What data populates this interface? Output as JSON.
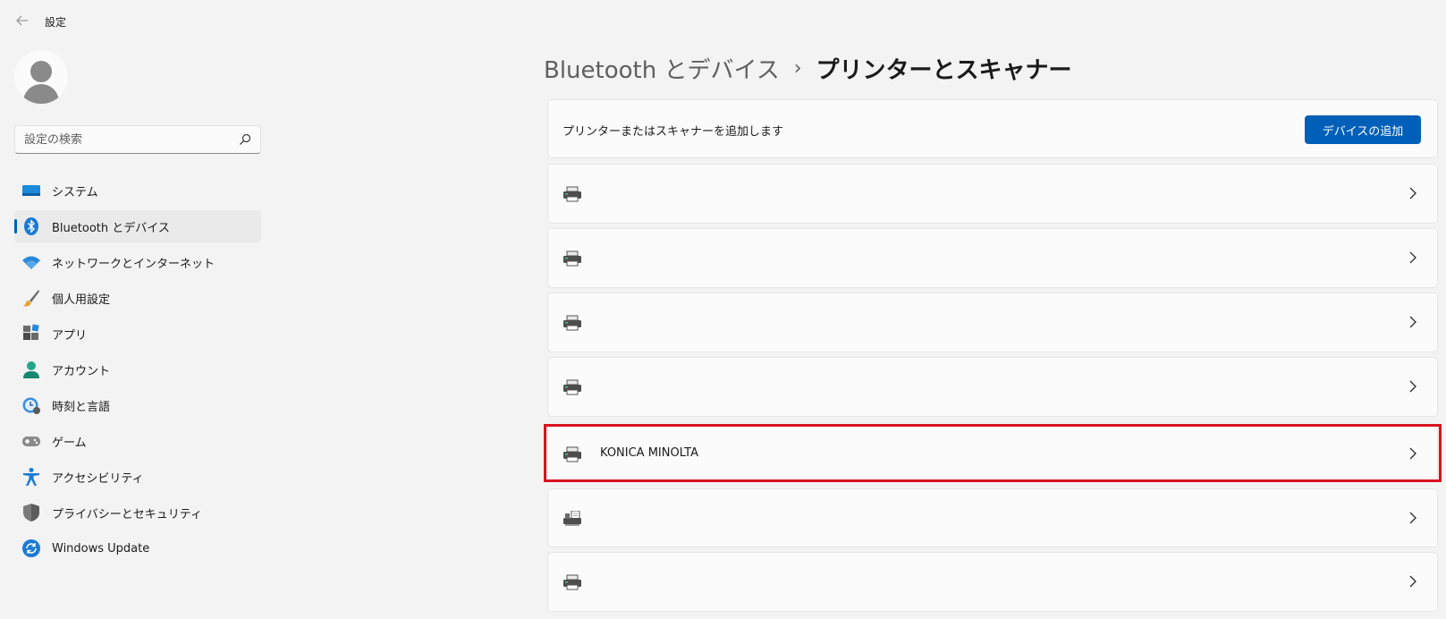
{
  "window": {
    "title": "設定",
    "back_icon": "back-arrow-icon"
  },
  "sidebar": {
    "search_placeholder": "設定の検索",
    "items": [
      {
        "label": "システム",
        "icon": "system-icon",
        "selected": false
      },
      {
        "label": "Bluetooth とデバイス",
        "icon": "bluetooth-icon",
        "selected": true
      },
      {
        "label": "ネットワークとインターネット",
        "icon": "wifi-icon",
        "selected": false
      },
      {
        "label": "個人用設定",
        "icon": "brush-icon",
        "selected": false
      },
      {
        "label": "アプリ",
        "icon": "apps-icon",
        "selected": false
      },
      {
        "label": "アカウント",
        "icon": "account-icon",
        "selected": false
      },
      {
        "label": "時刻と言語",
        "icon": "time-language-icon",
        "selected": false
      },
      {
        "label": "ゲーム",
        "icon": "gamepad-icon",
        "selected": false
      },
      {
        "label": "アクセシビリティ",
        "icon": "accessibility-icon",
        "selected": false
      },
      {
        "label": "プライバシーとセキュリティ",
        "icon": "shield-icon",
        "selected": false
      },
      {
        "label": "Windows Update",
        "icon": "windows-update-icon",
        "selected": false
      }
    ]
  },
  "main": {
    "breadcrumb": {
      "parent": "Bluetooth とデバイス",
      "separator": "›",
      "current": "プリンターとスキャナー"
    },
    "add_card": {
      "text": "プリンターまたはスキャナーを追加します",
      "button_label": "デバイスの追加"
    },
    "printers": [
      {
        "name": "",
        "icon": "printer-icon"
      },
      {
        "name": "",
        "icon": "printer-icon"
      },
      {
        "name": "",
        "icon": "printer-icon"
      },
      {
        "name": "",
        "icon": "printer-icon"
      },
      {
        "name": "KONICA MINOLTA",
        "icon": "printer-icon",
        "highlighted": true
      },
      {
        "name": "",
        "icon": "fax-icon"
      },
      {
        "name": "",
        "icon": "printer-icon"
      }
    ]
  },
  "colors": {
    "accent": "#005fb8",
    "highlight": "#d8131e",
    "background": "#f3f3f3",
    "card": "#fbfbfb"
  }
}
